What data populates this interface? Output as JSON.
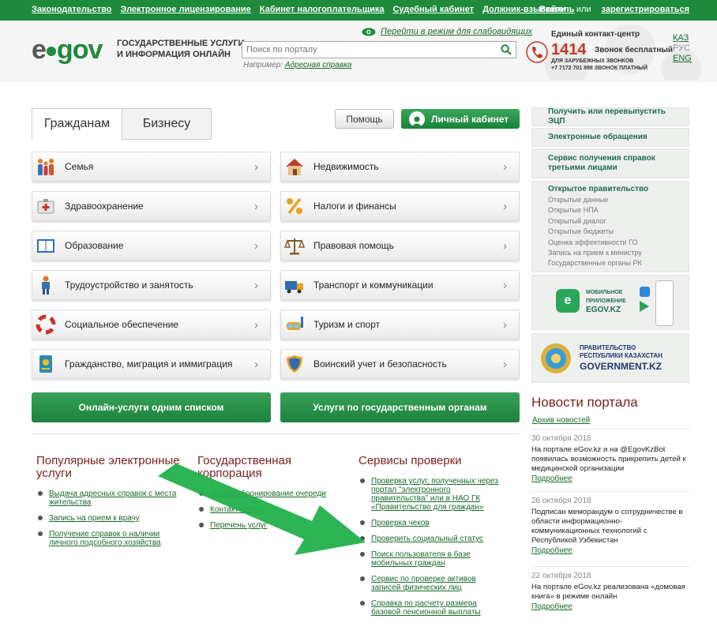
{
  "topbar": {
    "links": [
      "Законодательство",
      "Электронное лицензирование",
      "Кабинет налогоплательщика",
      "Судебный кабинет",
      "Должник-взыскатель"
    ],
    "login": "Войти",
    "or": "или",
    "register": "зарегистрироваться"
  },
  "header": {
    "logo_e": "e",
    "logo_gov": "gov",
    "tagline_line1": "Государственные услуги",
    "tagline_line2": "и информация онлайн",
    "impaired_link": "Перейти в режим для слабовидящих",
    "search_placeholder": "Поиск по порталу",
    "example_label": "Например:",
    "example_link": "Адресная справка",
    "contact_title": "Единый контакт-центр",
    "contact_number": "1414",
    "contact_free": "Звонок бесплатный",
    "contact_abroad_1": "Для зарубежных звонков",
    "contact_abroad_2": "+7 7172 701 898 звонок платный",
    "langs": [
      "ҚАЗ",
      "РУС",
      "ENG"
    ],
    "current_lang": "РУС"
  },
  "tabs": [
    "Гражданам",
    "Бизнесу"
  ],
  "buttons": {
    "help": "Помощь",
    "cabinet": "Личный кабинет",
    "online_list": "Онлайн-услуги одним списком",
    "by_agency": "Услуги по государственным органам"
  },
  "categories": [
    {
      "label": "Семья",
      "icon": "family-icon"
    },
    {
      "label": "Недвижимость",
      "icon": "house-icon"
    },
    {
      "label": "Здравоохранение",
      "icon": "first-aid-icon"
    },
    {
      "label": "Налоги и финансы",
      "icon": "percent-icon"
    },
    {
      "label": "Образование",
      "icon": "book-icon"
    },
    {
      "label": "Правовая помощь",
      "icon": "scales-icon"
    },
    {
      "label": "Трудоустройство и занятость",
      "icon": "worker-icon"
    },
    {
      "label": "Транспорт и коммуникации",
      "icon": "truck-icon"
    },
    {
      "label": "Социальное обеспечение",
      "icon": "lifebuoy-icon"
    },
    {
      "label": "Туризм и спорт",
      "icon": "diving-mask-icon"
    },
    {
      "label": "Гражданство, миграция и иммиграция",
      "icon": "passport-icon"
    },
    {
      "label": "Воинский учет и безопасность",
      "icon": "shield-icon"
    }
  ],
  "popular": {
    "title": "Популярные электронные услуги",
    "items": [
      "Выдача адресных справок с места жительства",
      "Запись на прием к врачу",
      "Получение справок о наличии личного подсобного хозяйства"
    ]
  },
  "corporation": {
    "title": "Государственная корпорация",
    "items": [
      "Онлайн-бронирование очереди",
      "Контакт-центр",
      "Перечень услуг"
    ]
  },
  "check_services": {
    "title": "Сервисы проверки",
    "items": [
      "Проверка услуг, полученных через портал \"электронного правительства\" или в НАО ГК «Правительство для граждан»",
      "Проверка чеков",
      "Проверить социальный статус",
      "Поиск пользователя в базе мобильных граждан",
      "Сервис по проверке активов записей физических лиц",
      "Справка по расчету размера базовой пенсионной выплаты"
    ]
  },
  "right": {
    "links": [
      "Получить или перевыпустить ЭЦП",
      "Электронные обращения",
      "Сервис получения справок третьими лицами"
    ],
    "open_gov_title": "Открытое правительство",
    "open_gov_items": [
      "Открытые данные",
      "Открытые НПА",
      "Открытый диалог",
      "Открытые бюджеты",
      "Оценка эффективности ГО",
      "Запись на прием к министру",
      "Государственные органы РК"
    ],
    "mobile_line1": "Мобильное",
    "mobile_line2": "приложение",
    "mobile_line3": "EGOV.KZ",
    "gov_line1": "Правительство",
    "gov_line2": "Республики Казахстан",
    "gov_line3": "GOVERNMENT.KZ"
  },
  "news": {
    "title": "Новости портала",
    "archive": "Архив новостей",
    "more": "Подробнее",
    "items": [
      {
        "date": "30 октября 2018",
        "text": "На портале eGov.kz и на @EgovKzBot появилась возможность прикрепить детей к медицинской организации"
      },
      {
        "date": "26 октября 2018",
        "text": "Подписан меморандум о сотрудничестве в области информационно-коммуникационных технологий с Республикой Узбекистан"
      },
      {
        "date": "22 октября 2018",
        "text": "На портале eGov.kz реализована «домовая книга» в режиме онлайн"
      }
    ]
  },
  "colors": {
    "brand_green": "#1d8a3c",
    "heading_red": "#7a1f1f",
    "arrow_green": "#22b04b"
  }
}
